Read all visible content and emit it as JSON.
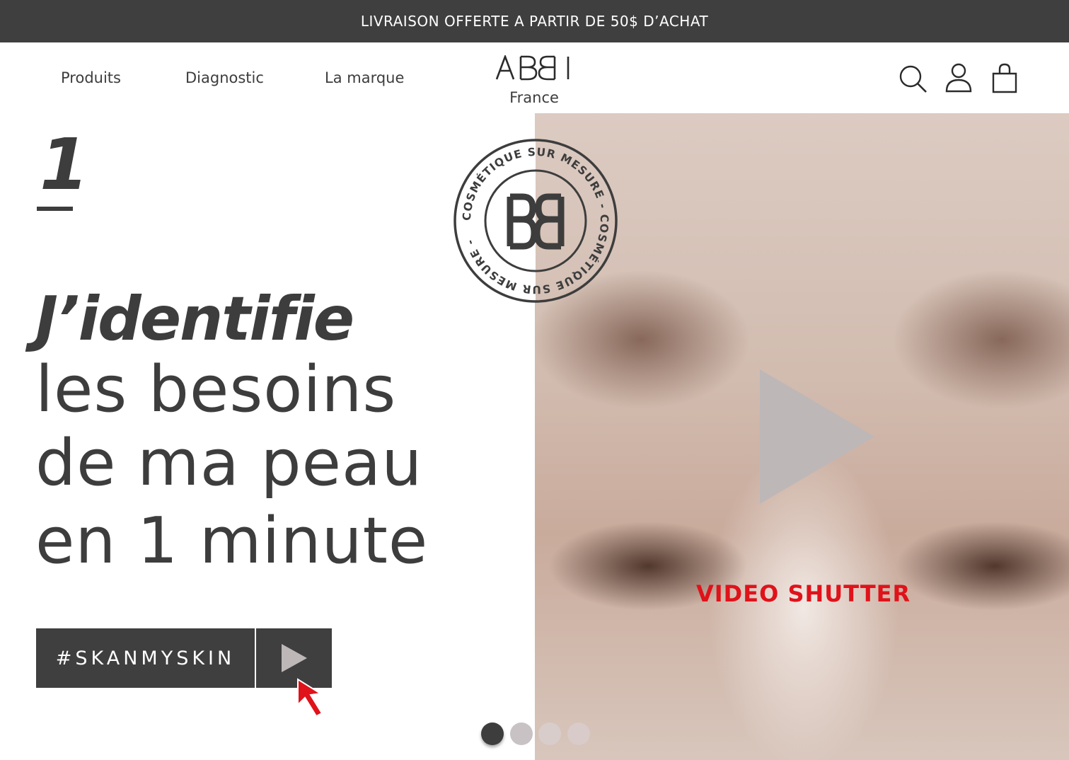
{
  "promo": {
    "text": "LIVRAISON OFFERTE A PARTIR DE 50$ D’ACHAT"
  },
  "nav": {
    "items": [
      {
        "label": "Produits"
      },
      {
        "label": "Diagnostic"
      },
      {
        "label": "La marque"
      }
    ]
  },
  "logo": {
    "word": "ABBI",
    "region": "France"
  },
  "header_icons": [
    "search-icon",
    "user-icon",
    "shopping-bag-icon"
  ],
  "stamp": {
    "ring_text": "COSMÉTIQUE SUR MESURE - COSMÉTIQUE SUR MESURE -",
    "monogram": "BB"
  },
  "hero": {
    "slide_number": "1",
    "headline_strong": "J’identifie",
    "headline_lines": [
      "les besoins",
      "de ma peau",
      "en 1 minute"
    ],
    "cta_label": "#SKANMYSKIN",
    "video_label": "VIDEO SHUTTER"
  },
  "carousel": {
    "total": 4,
    "active": 1
  },
  "colors": {
    "dark": "#3f3f3f",
    "text": "#3d3d3d",
    "accent_red": "#e0121a",
    "play_grey": "#bdb7b8"
  }
}
